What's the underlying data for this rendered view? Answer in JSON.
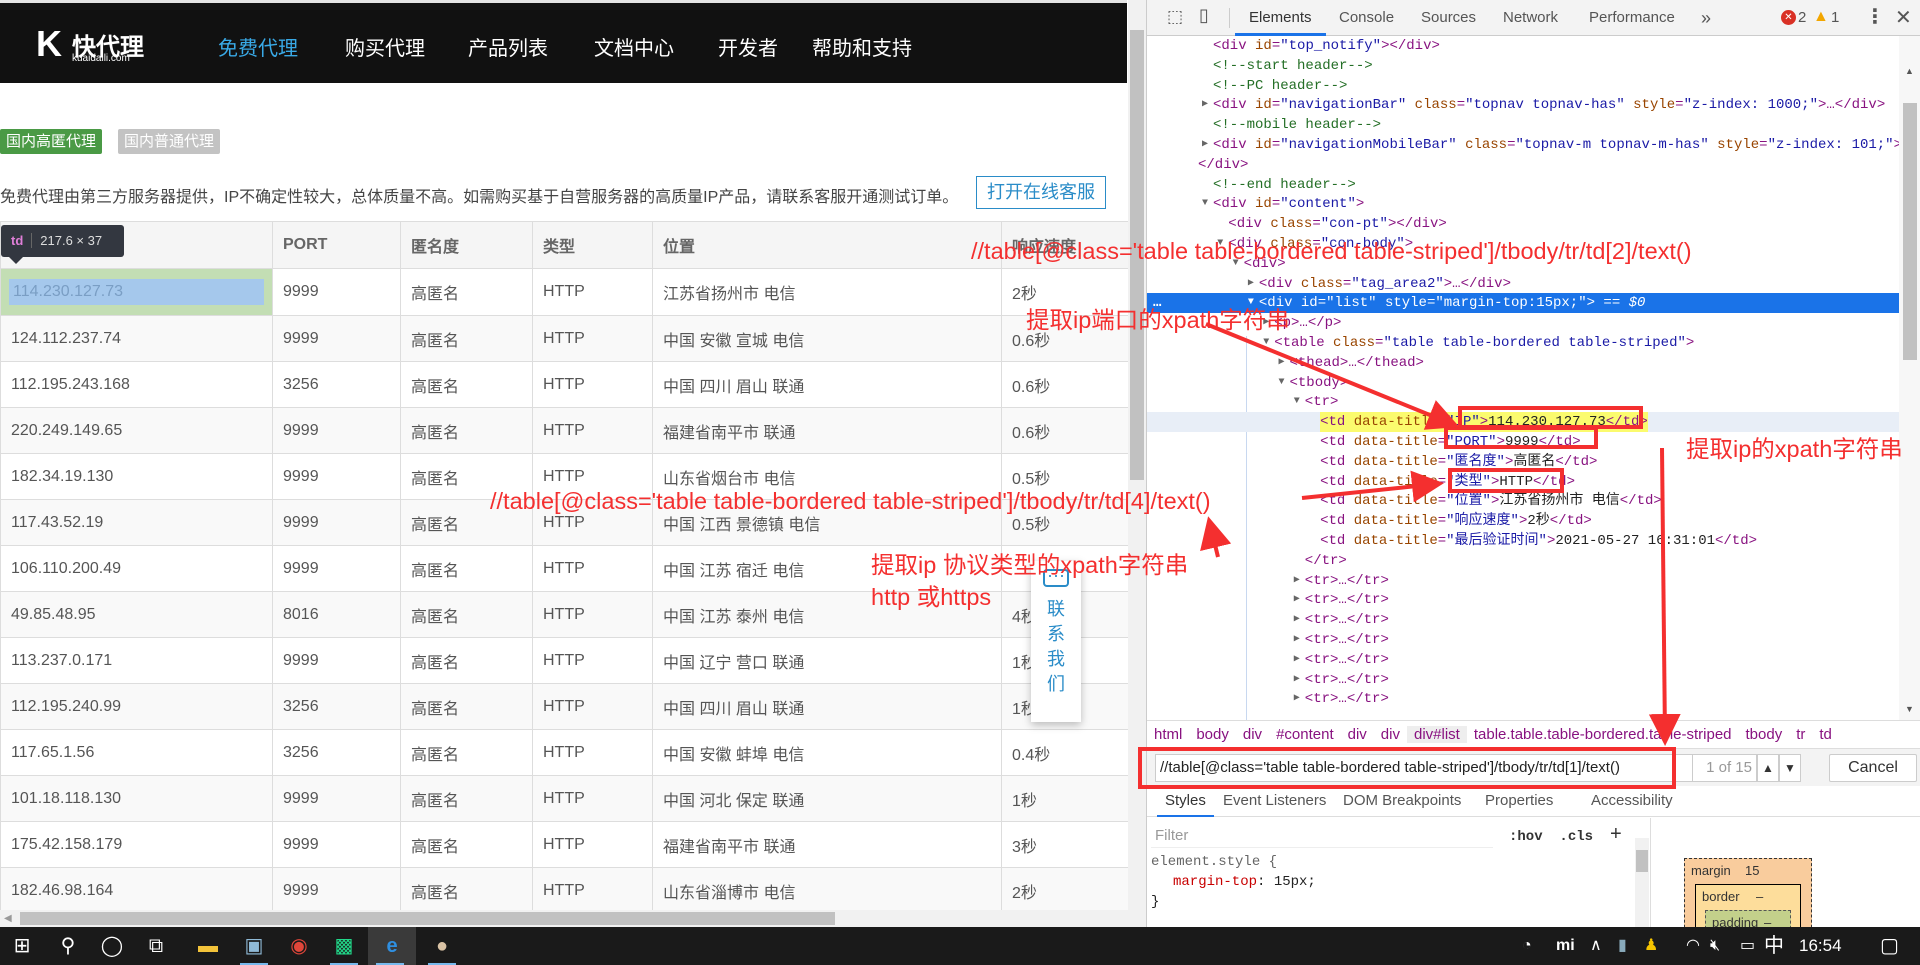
{
  "site": {
    "logo": {
      "mark": "K",
      "name": "快代理",
      "domain": "kuaidaili.com"
    },
    "nav": [
      "免费代理",
      "购买代理",
      "产品列表",
      "文档中心",
      "开发者",
      "帮助和支持"
    ],
    "active_nav": "免费代理",
    "tags": [
      {
        "label": "国内高匿代理",
        "color": "#4a9a45"
      },
      {
        "label": "国内普通代理",
        "color": "#c3c3c3"
      }
    ],
    "description": "免费代理由第三方服务器提供，IP不确定性较大，总体质量不高。如需购买基于自营服务器的高质量IP产品，请联系客服开通测试订单。",
    "kefu_button": "打开在线客服",
    "table": {
      "headers": [
        "",
        "PORT",
        "匿名度",
        "类型",
        "位置",
        "响应速度"
      ],
      "rows": [
        [
          "114.230.127.73",
          "9999",
          "高匿名",
          "HTTP",
          "江苏省扬州市 电信",
          "2秒"
        ],
        [
          "124.112.237.74",
          "9999",
          "高匿名",
          "HTTP",
          "中国 安徽 宣城 电信",
          "0.6秒"
        ],
        [
          "112.195.243.168",
          "3256",
          "高匿名",
          "HTTP",
          "中国 四川 眉山 联通",
          "0.6秒"
        ],
        [
          "220.249.149.65",
          "9999",
          "高匿名",
          "HTTP",
          "福建省南平市 联通",
          "0.6秒"
        ],
        [
          "182.34.19.130",
          "9999",
          "高匿名",
          "HTTP",
          "山东省烟台市 电信",
          "0.5秒"
        ],
        [
          "117.43.52.19",
          "9999",
          "高匿名",
          "HTTP",
          "中国 江西 景德镇 电信",
          "0.5秒"
        ],
        [
          "106.110.200.49",
          "9999",
          "高匿名",
          "HTTP",
          "中国 江苏 宿迁 电信",
          ""
        ],
        [
          "49.85.48.95",
          "8016",
          "高匿名",
          "HTTP",
          "中国 江苏 泰州 电信",
          "4秒"
        ],
        [
          "113.237.0.171",
          "9999",
          "高匿名",
          "HTTP",
          "中国 辽宁 营口 联通",
          "1秒"
        ],
        [
          "112.195.240.99",
          "3256",
          "高匿名",
          "HTTP",
          "中国 四川 眉山 联通",
          "1秒"
        ],
        [
          "117.65.1.56",
          "3256",
          "高匿名",
          "HTTP",
          "中国 安徽 蚌埠 电信",
          "0.4秒"
        ],
        [
          "101.18.118.130",
          "9999",
          "高匿名",
          "HTTP",
          "中国 河北 保定 联通",
          "1秒"
        ],
        [
          "175.42.158.179",
          "9999",
          "高匿名",
          "HTTP",
          "福建省南平市 联通",
          "3秒"
        ],
        [
          "182.46.98.164",
          "9999",
          "高匿名",
          "HTTP",
          "山东省淄博市 电信",
          "2秒"
        ]
      ]
    },
    "inspect_tooltip": {
      "tag": "td",
      "size": "217.6 × 37"
    },
    "contact_widget": {
      "icon": "chat-bubble-icon",
      "label": "联系我们"
    }
  },
  "devtools": {
    "tabs": [
      "Elements",
      "Console",
      "Sources",
      "Network",
      "Performance"
    ],
    "active_tab": "Elements",
    "more_tabs": "»",
    "errors": "2",
    "warnings": "1",
    "dom_lines": [
      {
        "level": 1,
        "tri": "",
        "text": "<div id=\"top_notify\"></div>"
      },
      {
        "level": 1,
        "tri": "",
        "text": "<!--start header-->"
      },
      {
        "level": 1,
        "tri": "",
        "text": "<!--PC header-->"
      },
      {
        "level": 1,
        "tri": "right",
        "text": "<div id=\"navigationBar\" class=\"topnav topnav-has\" style=\"z-index: 1000;\">…</div>"
      },
      {
        "level": 1,
        "tri": "",
        "text": "<!--mobile header-->"
      },
      {
        "level": 1,
        "tri": "right",
        "text": "<div id=\"navigationMobileBar\" class=\"topnav-m topnav-m-has\" style=\"z-index: 101;\">…"
      },
      {
        "level": 0,
        "tri": "",
        "text": "</div>"
      },
      {
        "level": 1,
        "tri": "",
        "text": "<!--end header-->"
      },
      {
        "level": 1,
        "tri": "down",
        "text": "<div id=\"content\">"
      },
      {
        "level": 2,
        "tri": "",
        "text": "<div class=\"con-pt\"></div>"
      },
      {
        "level": 2,
        "tri": "down",
        "text": "<div class=\"con-body\">"
      },
      {
        "level": 3,
        "tri": "down",
        "text": "<div>"
      },
      {
        "level": 4,
        "tri": "right",
        "text": "<div class=\"tag_area2\">…</div>"
      },
      {
        "level": 4,
        "tri": "down",
        "text": "<div id=\"list\" style=\"margin-top:15px;\">",
        "suffix": " == $0",
        "selected": true
      },
      {
        "level": 5,
        "tri": "right",
        "text": "<p>…</p>"
      },
      {
        "level": 5,
        "tri": "down",
        "text": "<table class=\"table table-bordered table-striped\">"
      },
      {
        "level": 6,
        "tri": "right",
        "text": "<thead>…</thead>"
      },
      {
        "level": 6,
        "tri": "down",
        "text": "<tbody>"
      },
      {
        "level": 7,
        "tri": "down",
        "text": "<tr>"
      },
      {
        "level": 8,
        "tri": "",
        "text": "<td data-title=\"IP\">114.230.127.73</td>",
        "hovered": true
      },
      {
        "level": 8,
        "tri": "",
        "text": "<td data-title=\"PORT\">9999</td>"
      },
      {
        "level": 8,
        "tri": "",
        "text": "<td data-title=\"匿名度\">高匿名</td>"
      },
      {
        "level": 8,
        "tri": "",
        "text": "<td data-title=\"类型\">HTTP</td>"
      },
      {
        "level": 8,
        "tri": "",
        "text": "<td data-title=\"位置\">江苏省扬州市   电信</td>"
      },
      {
        "level": 8,
        "tri": "",
        "text": "<td data-title=\"响应速度\">2秒</td>"
      },
      {
        "level": 8,
        "tri": "",
        "text": "<td data-title=\"最后验证时间\">2021-05-27 16:31:01</td>"
      },
      {
        "level": 7,
        "tri": "",
        "text": "</tr>"
      },
      {
        "level": 7,
        "tri": "right",
        "text": "<tr>…</tr>"
      },
      {
        "level": 7,
        "tri": "right",
        "text": "<tr>…</tr>"
      },
      {
        "level": 7,
        "tri": "right",
        "text": "<tr>…</tr>"
      },
      {
        "level": 7,
        "tri": "right",
        "text": "<tr>…</tr>"
      },
      {
        "level": 7,
        "tri": "right",
        "text": "<tr>…</tr>"
      },
      {
        "level": 7,
        "tri": "right",
        "text": "<tr>…</tr>"
      },
      {
        "level": 7,
        "tri": "right",
        "text": "<tr>…</tr>"
      }
    ],
    "breadcrumbs": [
      "html",
      "body",
      "div",
      "#content",
      "div",
      "div",
      "div#list",
      "table.table.table-bordered.table-striped",
      "tbody",
      "tr",
      "td"
    ],
    "breadcrumb_current": "div#list",
    "search": {
      "value": "//table[@class='table table-bordered table-striped']/tbody/tr/td[1]/text()",
      "count": "1 of 15",
      "cancel": "Cancel"
    },
    "sub_tabs": [
      "Styles",
      "Event Listeners",
      "DOM Breakpoints",
      "Properties",
      "Accessibility"
    ],
    "active_sub_tab": "Styles",
    "filter_placeholder": "Filter",
    "filter_tools": {
      "hov": ":hov",
      "cls": ".cls",
      "add": "+"
    },
    "styles": {
      "selector": "element.style {",
      "prop": "margin-top",
      "value": "15px;",
      "close": "}"
    },
    "box_model": {
      "margin_label": "margin",
      "margin_value": "15",
      "border_label": "border",
      "border_value": "–",
      "padding_label": "padding",
      "padding_value": "–"
    }
  },
  "annotations": {
    "xpath_port": "//table[@class='table table-bordered table-striped']/tbody/tr/td[2]/text()",
    "label_port": "提取ip端口的xpath字符串",
    "xpath_type": "//table[@class='table table-bordered table-striped']/tbody/tr/td[4]/text()",
    "label_type_1": "提取ip 协议类型的xpath字符串",
    "label_type_2": "http 或https",
    "label_ip": "提取ip的xpath字符串",
    "color": "#f42f2f"
  },
  "taskbar": {
    "icons": [
      "windows-start-icon",
      "search-icon",
      "cortana-icon",
      "task-view-icon",
      "file-explorer-icon",
      "monitor-app-icon",
      "chrome-icon",
      "pycharm-icon",
      "ie-browser-icon",
      "avatar-app-icon"
    ],
    "tray": {
      "ime": "中",
      "time": "16:54"
    }
  }
}
